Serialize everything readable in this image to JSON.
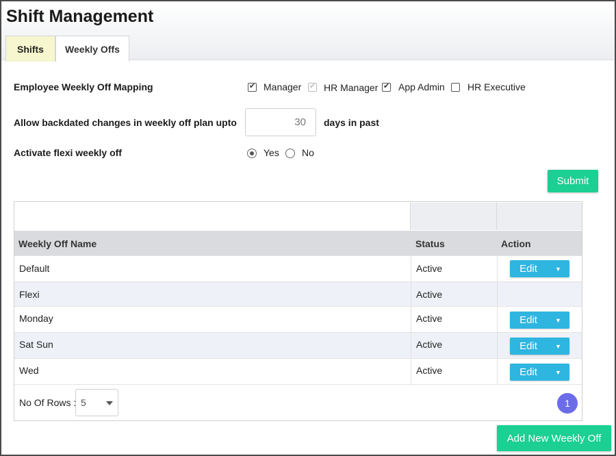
{
  "page": {
    "title": "Shift Management"
  },
  "tabs": [
    {
      "label": "Shifts"
    },
    {
      "label": "Weekly Offs"
    }
  ],
  "settings": {
    "mapping_label": "Employee Weekly Off Mapping",
    "roles": [
      {
        "label": "Manager",
        "checked": true,
        "disabled": false
      },
      {
        "label": "HR Manager",
        "checked": true,
        "disabled": true
      },
      {
        "label": "App Admin",
        "checked": true,
        "disabled": false
      },
      {
        "label": "HR Executive",
        "checked": false,
        "disabled": false
      }
    ],
    "backdated_label": "Allow backdated changes in weekly off plan upto",
    "backdated_value": "30",
    "backdated_suffix": "days in past",
    "flexi_label": "Activate flexi weekly off",
    "flexi_options": [
      {
        "label": "Yes",
        "selected": true
      },
      {
        "label": "No",
        "selected": false
      }
    ],
    "submit_label": "Submit"
  },
  "table": {
    "headers": {
      "name": "Weekly Off Name",
      "status": "Status",
      "action": "Action"
    },
    "rows": [
      {
        "name": "Default",
        "status": "Active",
        "has_edit": true
      },
      {
        "name": "Flexi",
        "status": "Active",
        "has_edit": false
      },
      {
        "name": "Monday",
        "status": "Active",
        "has_edit": true
      },
      {
        "name": "Sat Sun",
        "status": "Active",
        "has_edit": true
      },
      {
        "name": "Wed",
        "status": "Active",
        "has_edit": true
      }
    ],
    "edit_label": "Edit",
    "rows_label": "No Of Rows :",
    "rows_value": "5",
    "current_page": "1"
  },
  "add_button_label": "Add New Weekly Off",
  "colors": {
    "accent_green": "#1ccf92",
    "edit_blue": "#2eb5e0",
    "page_badge": "#6c6ce8",
    "active_tab": "#f6f6cf"
  }
}
